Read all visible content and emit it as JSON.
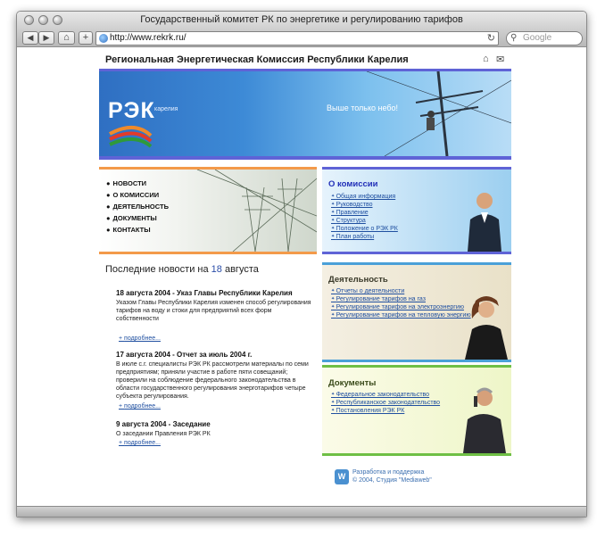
{
  "browser": {
    "title": "Государственный комитет РК по энергетике и регулированию тарифов",
    "url": "http://www.rekrk.ru/",
    "search_placeholder": "Google",
    "nav_back": "◀",
    "nav_forward": "▶",
    "home_symbol": "⌂",
    "add_symbol": "+",
    "reload_symbol": "↻"
  },
  "site": {
    "title": "Региональная Энергетическая Комиссия Республики Карелия",
    "banner": {
      "logo": "РЭК",
      "logo_sub": "карелия",
      "slogan": "Выше только небо!"
    },
    "nav": [
      {
        "label": "НОВОСТИ"
      },
      {
        "label": "О КОМИССИИ"
      },
      {
        "label": "ДЕЯТЕЛЬНОСТЬ"
      },
      {
        "label": "ДОКУМЕНТЫ"
      },
      {
        "label": "КОНТАКТЫ"
      }
    ],
    "news_heading": {
      "prefix": "Последние новости на",
      "day": "18",
      "month": "августа"
    },
    "news": [
      {
        "title": "18 августа 2004 - Указ Главы Республики Карелия",
        "text": "Указом Главы Республики Карелия изменен способ регулирования тарифов на воду и стоки для предприятий всех форм собственности",
        "more": "подробнее..."
      },
      {
        "title": "17 августа 2004 - Отчет за июль 2004 г.",
        "text": "В июле с.г. специалисты РЭК РК рассмотрели материалы по семи предприятиям; приняли участие в работе пяти совещаний; проверили на соблюдение федерального законодательства в области государственного регулирования энерготарифов четыре субъекта регулирования.",
        "more": "подробнее..."
      },
      {
        "title": "9 августа 2004 - Заседание",
        "text": "О заседании Правления РЭК РК",
        "more": "подробнее..."
      }
    ],
    "panels": {
      "commission": {
        "title": "О комиссии",
        "links": [
          "Общая информация",
          "Руководство",
          "Правление",
          "Структура",
          "Положение о РЭК РК",
          "План работы"
        ]
      },
      "activity": {
        "title": "Деятельность",
        "links": [
          "Отчеты о деятельности",
          "Регулирование тарифов на газ",
          "Регулирование тарифов на электроэнергию",
          "Регулирование тарифов на тепловую энергию"
        ]
      },
      "documents": {
        "title": "Документы",
        "links": [
          "Федеральное законодательство",
          "Республиканское законодательство",
          "Постановления РЭК РК"
        ]
      }
    },
    "footer": {
      "logo": "W",
      "line1": "Разработка и поддержка",
      "line2": "© 2004, Студия \"Mediaweb\""
    }
  },
  "colors": {
    "banner_border": "#5f63d6",
    "nav_border": "#f39a4a",
    "panel_commission": "#5f63d6",
    "panel_activity": "#4aa0d8",
    "panel_documents": "#6fbf45",
    "link": "#1f4fa0"
  }
}
